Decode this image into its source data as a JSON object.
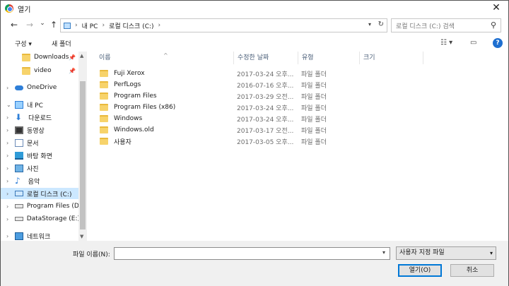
{
  "window": {
    "title": "열기",
    "close_glyph": "✕"
  },
  "nav_buttons": {
    "back": "←",
    "forward": "→",
    "recent": "⌄",
    "up": "↑"
  },
  "address": {
    "segments": [
      "내 PC",
      "로컬 디스크 (C:)"
    ],
    "separator": "›"
  },
  "search": {
    "placeholder": "로컬 디스크 (C:) 검색"
  },
  "commands": {
    "organize": "구성 ▾",
    "new_folder": "새 폴더",
    "help": "?"
  },
  "sidebar": {
    "items": [
      {
        "label": "Downloads",
        "icon": "folder-icon",
        "pinned": true
      },
      {
        "label": "video",
        "icon": "folder-icon",
        "pinned": true
      },
      {
        "label": "OneDrive",
        "icon": "cloud-icon",
        "chevron": "›"
      },
      {
        "label": "내 PC",
        "icon": "pc-icon",
        "chevron": "⌄"
      },
      {
        "label": "다운로드",
        "icon": "download-icon",
        "chevron": "›"
      },
      {
        "label": "동영상",
        "icon": "video-icon",
        "chevron": "›"
      },
      {
        "label": "문서",
        "icon": "document-icon",
        "chevron": "›"
      },
      {
        "label": "바탕 화면",
        "icon": "desktop-icon",
        "chevron": "›"
      },
      {
        "label": "사진",
        "icon": "pictures-icon",
        "chevron": "›"
      },
      {
        "label": "음악",
        "icon": "music-icon",
        "chevron": "›"
      },
      {
        "label": "로컬 디스크 (C:)",
        "icon": "local-disk-icon",
        "chevron": "›",
        "selected": true
      },
      {
        "label": "Program Files (D",
        "icon": "drive-icon",
        "chevron": "›"
      },
      {
        "label": "DataStorage (E:)",
        "icon": "drive-icon",
        "chevron": "›"
      },
      {
        "label": "네트워크",
        "icon": "network-icon",
        "chevron": "›"
      }
    ]
  },
  "columns": {
    "name": "이름",
    "date": "수정한 날짜",
    "type": "유형",
    "size": "크기"
  },
  "files": [
    {
      "name": "Fuji Xerox",
      "date": "2017-03-24 오후...",
      "type": "파일 폴더"
    },
    {
      "name": "PerfLogs",
      "date": "2016-07-16 오후...",
      "type": "파일 폴더"
    },
    {
      "name": "Program Files",
      "date": "2017-03-29 오전...",
      "type": "파일 폴더"
    },
    {
      "name": "Program Files (x86)",
      "date": "2017-03-24 오후...",
      "type": "파일 폴더"
    },
    {
      "name": "Windows",
      "date": "2017-03-24 오후...",
      "type": "파일 폴더"
    },
    {
      "name": "Windows.old",
      "date": "2017-03-17 오전...",
      "type": "파일 폴더"
    },
    {
      "name": "사용자",
      "date": "2017-03-05 오후...",
      "type": "파일 폴더"
    }
  ],
  "footer": {
    "filename_label": "파일 이름(N):",
    "filename_value": "",
    "filetype": "사용자 지정 파일",
    "open_button": "열기(O)",
    "cancel_button": "취소"
  },
  "colors": {
    "selection": "#cce8ff",
    "accent": "#0078d7",
    "folder": "#f7d36b"
  }
}
